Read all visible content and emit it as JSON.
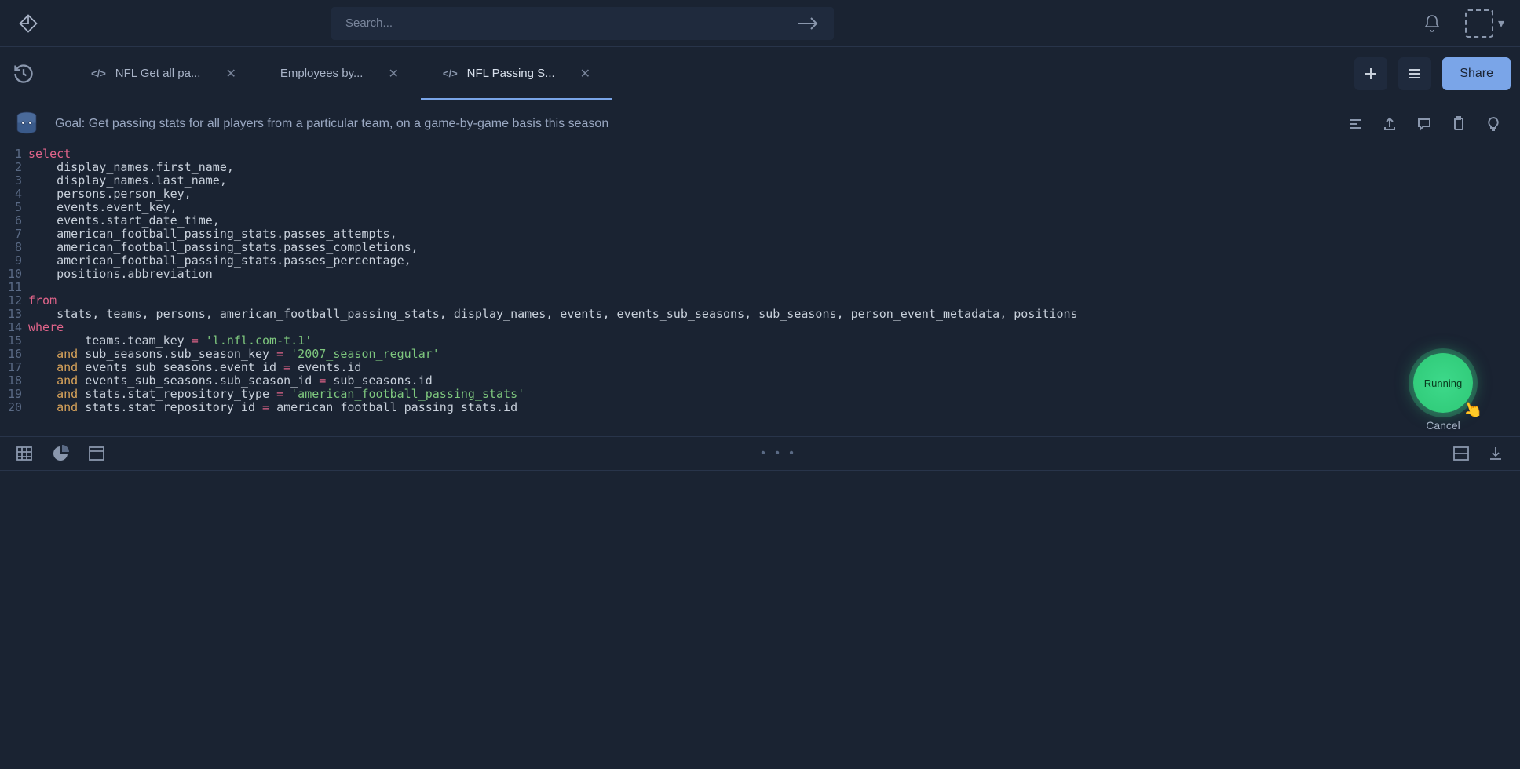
{
  "search": {
    "placeholder": "Search..."
  },
  "tabs": [
    {
      "label": "NFL Get all pa...",
      "has_code_icon": true,
      "active": false
    },
    {
      "label": "Employees by...",
      "has_code_icon": false,
      "active": false
    },
    {
      "label": "NFL Passing S...",
      "has_code_icon": true,
      "active": true
    }
  ],
  "share_label": "Share",
  "goal": "Goal: Get passing stats for all players from a particular team, on a game-by-game basis this season",
  "code_lines": [
    {
      "n": 1,
      "tokens": [
        [
          "kw",
          "select"
        ]
      ]
    },
    {
      "n": 2,
      "tokens": [
        [
          "plain",
          "    display_names.first_name,"
        ]
      ]
    },
    {
      "n": 3,
      "tokens": [
        [
          "plain",
          "    display_names.last_name,"
        ]
      ]
    },
    {
      "n": 4,
      "tokens": [
        [
          "plain",
          "    persons.person_key,"
        ]
      ]
    },
    {
      "n": 5,
      "tokens": [
        [
          "plain",
          "    events.event_key,"
        ]
      ]
    },
    {
      "n": 6,
      "tokens": [
        [
          "plain",
          "    events.start_date_time,"
        ]
      ]
    },
    {
      "n": 7,
      "tokens": [
        [
          "plain",
          "    american_football_passing_stats.passes_attempts,"
        ]
      ]
    },
    {
      "n": 8,
      "tokens": [
        [
          "plain",
          "    american_football_passing_stats.passes_completions,"
        ]
      ]
    },
    {
      "n": 9,
      "tokens": [
        [
          "plain",
          "    american_football_passing_stats.passes_percentage,"
        ]
      ]
    },
    {
      "n": 10,
      "tokens": [
        [
          "plain",
          "    positions.abbreviation"
        ]
      ]
    },
    {
      "n": 11,
      "tokens": [
        [
          "plain",
          ""
        ]
      ]
    },
    {
      "n": 12,
      "tokens": [
        [
          "kw",
          "from"
        ]
      ]
    },
    {
      "n": 13,
      "tokens": [
        [
          "plain",
          "    stats, teams, persons, american_football_passing_stats, display_names, events, events_sub_seasons, sub_seasons, person_event_metadata, positions"
        ]
      ]
    },
    {
      "n": 14,
      "tokens": [
        [
          "kw",
          "where"
        ]
      ]
    },
    {
      "n": 15,
      "tokens": [
        [
          "plain",
          "        teams.team_key "
        ],
        [
          "op",
          "="
        ],
        [
          "plain",
          " "
        ],
        [
          "str",
          "'l.nfl.com-t.1'"
        ]
      ]
    },
    {
      "n": 16,
      "tokens": [
        [
          "plain",
          "    "
        ],
        [
          "and",
          "and"
        ],
        [
          "plain",
          " sub_seasons.sub_season_key "
        ],
        [
          "op",
          "="
        ],
        [
          "plain",
          " "
        ],
        [
          "str",
          "'2007_season_regular'"
        ]
      ]
    },
    {
      "n": 17,
      "tokens": [
        [
          "plain",
          "    "
        ],
        [
          "and",
          "and"
        ],
        [
          "plain",
          " events_sub_seasons.event_id "
        ],
        [
          "op",
          "="
        ],
        [
          "plain",
          " events.id"
        ]
      ]
    },
    {
      "n": 18,
      "tokens": [
        [
          "plain",
          "    "
        ],
        [
          "and",
          "and"
        ],
        [
          "plain",
          " events_sub_seasons.sub_season_id "
        ],
        [
          "op",
          "="
        ],
        [
          "plain",
          " sub_seasons.id"
        ]
      ]
    },
    {
      "n": 19,
      "tokens": [
        [
          "plain",
          "    "
        ],
        [
          "and",
          "and"
        ],
        [
          "plain",
          " stats.stat_repository_type "
        ],
        [
          "op",
          "="
        ],
        [
          "plain",
          " "
        ],
        [
          "str",
          "'american_football_passing_stats'"
        ]
      ]
    },
    {
      "n": 20,
      "tokens": [
        [
          "plain",
          "    "
        ],
        [
          "and",
          "and"
        ],
        [
          "plain",
          " stats.stat_repository_id "
        ],
        [
          "op",
          "="
        ],
        [
          "plain",
          " american_football_passing_stats.id"
        ]
      ]
    }
  ],
  "run_button": {
    "label": "Running"
  },
  "cancel_label": "Cancel",
  "loading_dots": "• • •"
}
